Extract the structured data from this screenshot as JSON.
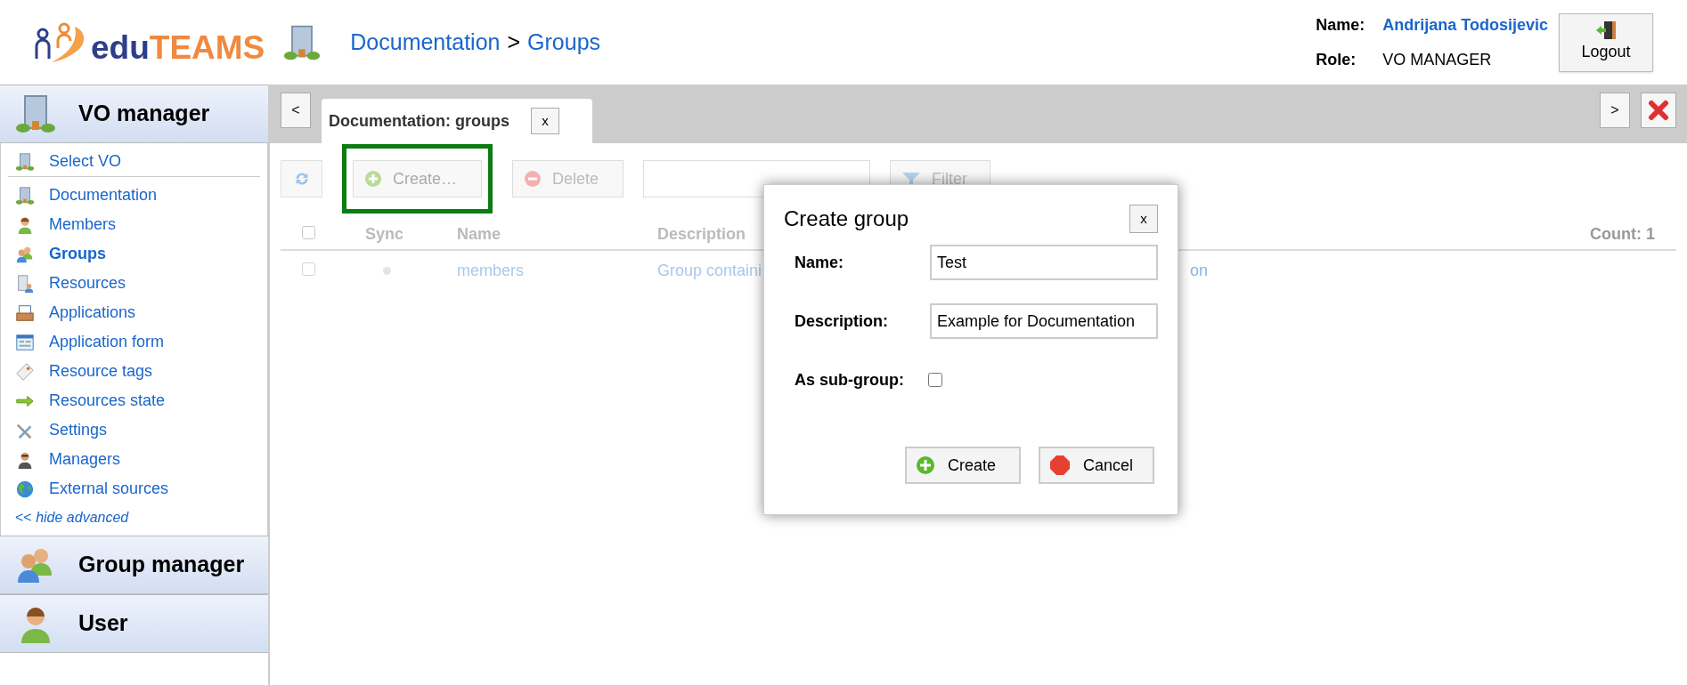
{
  "header": {
    "logo": {
      "text_main": "edu",
      "text_accent": "TEAMS"
    },
    "breadcrumb": {
      "parent": "Documentation",
      "separator": ">",
      "current": "Groups"
    },
    "user": {
      "name_label": "Name:",
      "name": "Andrijana Todosijevic",
      "role_label": "Role:",
      "role": "VO MANAGER"
    },
    "logout": "Logout"
  },
  "sidebar": {
    "sections": [
      {
        "title": "VO manager",
        "kind": "building",
        "items": [
          {
            "label": "Select VO",
            "kind": "building",
            "selected": false
          },
          {
            "label": "Documentation",
            "kind": "building",
            "selected": false
          },
          {
            "label": "Members",
            "kind": "person",
            "selected": false
          },
          {
            "label": "Groups",
            "kind": "group",
            "selected": true
          },
          {
            "label": "Resources",
            "kind": "server",
            "selected": false
          },
          {
            "label": "Applications",
            "kind": "inbox",
            "selected": false
          },
          {
            "label": "Application form",
            "kind": "form",
            "selected": false
          },
          {
            "label": "Resource tags",
            "kind": "tag",
            "selected": false
          },
          {
            "label": "Resources state",
            "kind": "arrow",
            "selected": false
          },
          {
            "label": "Settings",
            "kind": "tools",
            "selected": false
          },
          {
            "label": "Managers",
            "kind": "manager",
            "selected": false
          },
          {
            "label": "External sources",
            "kind": "globe",
            "selected": false
          }
        ],
        "toggle": "<< *hide advanced*"
      },
      {
        "title": "Group manager",
        "kind": "group"
      },
      {
        "title": "User",
        "kind": "person"
      }
    ]
  },
  "tabs": {
    "prev": "<",
    "next": ">",
    "items": [
      {
        "label": "Documentation: groups",
        "close": "x",
        "selected": true
      }
    ]
  },
  "toolbar": {
    "create": {
      "label": "Create…",
      "highlighted": true
    },
    "delete": "Delete",
    "filter": "Filter"
  },
  "table": {
    "columns": [
      "Sync",
      "Name",
      "Description"
    ],
    "select_all": {
      "checked": false
    },
    "count": "Count: 1",
    "rows": [
      {
        "checked": false,
        "name": "members",
        "description": "Group containi",
        "description_tail": "on"
      }
    ]
  },
  "dialog": {
    "title": "Create group",
    "close": "x",
    "fields": [
      {
        "label": "Name:",
        "kind": "text",
        "value": "Test"
      },
      {
        "label": "Description:",
        "kind": "text",
        "value": "Example for Documentation"
      },
      {
        "label": "As sub-group:",
        "kind": "checkbox",
        "checked": false
      }
    ],
    "buttons": [
      {
        "label": "Create",
        "kind": "create"
      },
      {
        "label": "Cancel",
        "kind": "cancel"
      }
    ]
  }
}
